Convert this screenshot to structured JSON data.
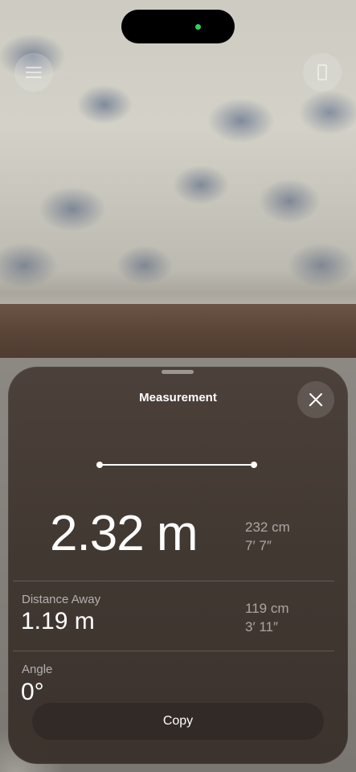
{
  "top_controls": {
    "left_icon": "list-icon",
    "right_icon": "ruler-icon"
  },
  "status": {
    "indicator_color": "#31d158"
  },
  "sheet": {
    "title": "Measurement",
    "close_icon": "close-icon",
    "measurement_icon": "line-segment-icon",
    "length": {
      "value": "2.32 m",
      "alt_metric": "232 cm",
      "alt_imperial": "7′ 7″"
    },
    "distance_away": {
      "label": "Distance Away",
      "value": "1.19 m",
      "alt_metric": "119 cm",
      "alt_imperial": "3′ 11″"
    },
    "angle": {
      "label": "Angle",
      "value": "0°"
    },
    "copy_label": "Copy"
  }
}
